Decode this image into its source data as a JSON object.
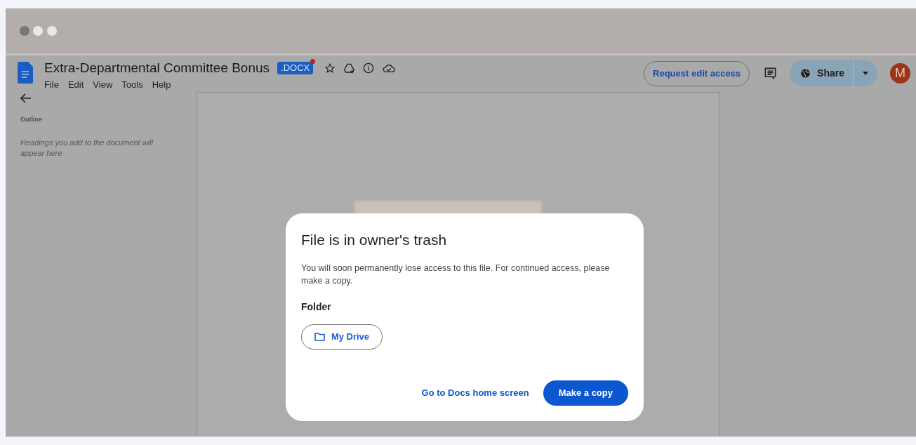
{
  "document": {
    "title": "Extra-Departmental Committee Bonus",
    "badge": ".DOCX",
    "menu": [
      "File",
      "Edit",
      "View",
      "Tools",
      "Help"
    ]
  },
  "header": {
    "request_button": "Request edit access",
    "share_button": "Share",
    "avatar": "M"
  },
  "sidebar": {
    "outline_label": "Outline",
    "outline_hint": "Headings you add to the document will appear here."
  },
  "dialog": {
    "title": "File is in owner's trash",
    "message": "You will soon permanently lose access to this file. For continued access, please make a copy.",
    "folder_label": "Folder",
    "folder_button": "My Drive",
    "actions": [
      {
        "label": "Go to Docs home screen",
        "kind": "text"
      },
      {
        "label": "Make a copy",
        "kind": "filled"
      }
    ]
  }
}
